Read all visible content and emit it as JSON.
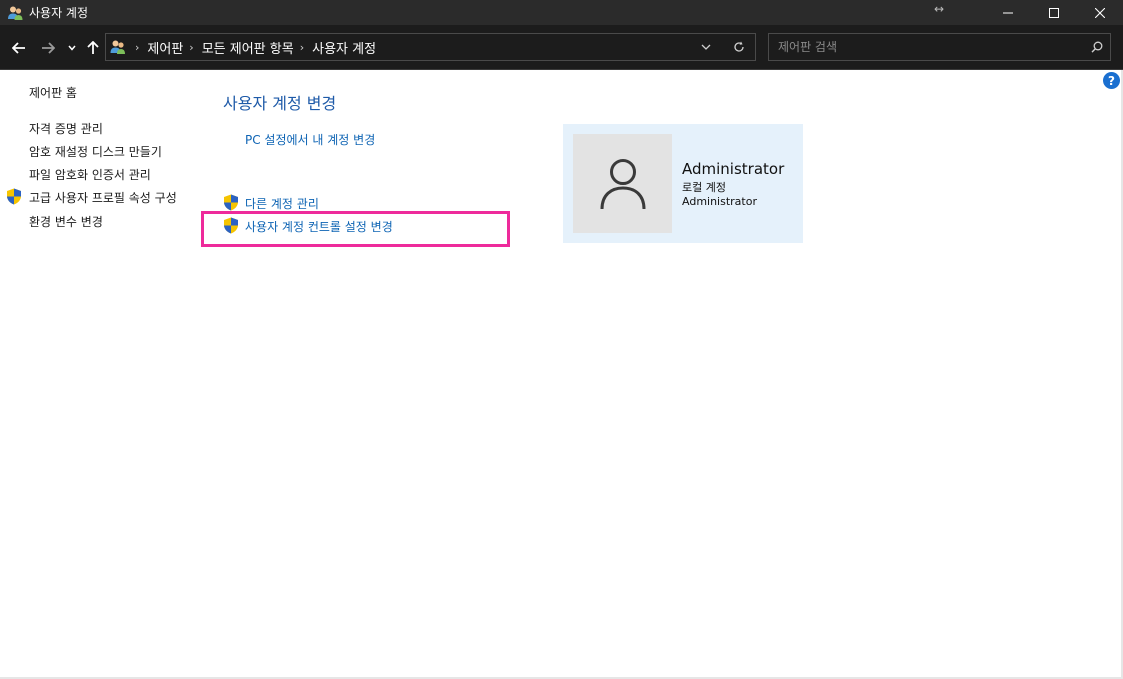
{
  "window": {
    "title": "사용자 계정",
    "app_icon": "users-icon",
    "resize_glyph": "↔",
    "controls": [
      "minimize-icon",
      "maximize-icon",
      "close-icon"
    ]
  },
  "navigation": {
    "buttons": [
      "back-arrow-icon",
      "forward-arrow-icon",
      "chevron-down-icon",
      "up-arrow-icon"
    ],
    "breadcrumbs": [
      "제어판",
      "모든 제어판 항목",
      "사용자 계정"
    ],
    "search": {
      "placeholder": "제어판 검색",
      "value": ""
    }
  },
  "sidebar": {
    "items": [
      {
        "label": "제어판 홈",
        "shield": false
      },
      {
        "label": "자격 증명 관리",
        "shield": false
      },
      {
        "label": "암호 재설정 디스크 만들기",
        "shield": false
      },
      {
        "label": "파일 암호화 인증서 관리",
        "shield": false
      },
      {
        "label": "고급 사용자 프로필 속성 구성",
        "shield": true
      },
      {
        "label": "환경 변수 변경",
        "shield": false
      }
    ]
  },
  "main": {
    "title": "사용자 계정 변경",
    "links": [
      {
        "label": "PC 설정에서 내 계정 변경",
        "shield": false
      },
      {
        "label": "다른 계정 관리",
        "shield": true
      },
      {
        "label": "사용자 계정 컨트롤 설정 변경",
        "shield": true,
        "highlighted": true
      }
    ]
  },
  "account": {
    "name": "Administrator",
    "type": "로컬 계정",
    "group": "Administrator",
    "avatar_icon": "user-silhouette-icon"
  },
  "help": {
    "label": "?"
  },
  "colors": {
    "titlebar": "#2b2b2b",
    "navbar": "#1c1c1c",
    "link": "#0e64b4",
    "heading": "#1e5aa8",
    "highlight": "#ee2a9b",
    "tile": "#e5f1fb"
  }
}
